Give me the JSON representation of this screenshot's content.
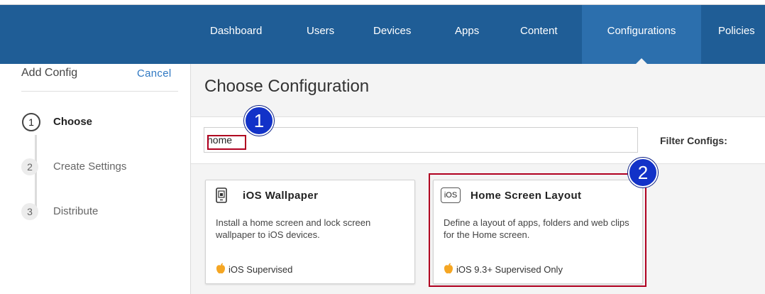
{
  "nav": {
    "items": [
      {
        "label": "Dashboard",
        "active": false
      },
      {
        "label": "Users",
        "active": false
      },
      {
        "label": "Devices",
        "active": false
      },
      {
        "label": "Apps",
        "active": false
      },
      {
        "label": "Content",
        "active": false
      },
      {
        "label": "Configurations",
        "active": true
      },
      {
        "label": "Policies",
        "active": false
      }
    ]
  },
  "sidebar": {
    "title": "Add Config",
    "cancel_label": "Cancel",
    "steps": [
      {
        "number": "1",
        "label": "Choose",
        "active": true
      },
      {
        "number": "2",
        "label": "Create Settings",
        "active": false
      },
      {
        "number": "3",
        "label": "Distribute",
        "active": false
      }
    ]
  },
  "main": {
    "title": "Choose Configuration",
    "search": {
      "value": "home",
      "placeholder": ""
    },
    "filter_label": "Filter Configs:",
    "cards": [
      {
        "title": "iOS Wallpaper",
        "description": "Install a home screen and lock screen wallpaper to iOS devices.",
        "footer": "iOS Supervised",
        "icon": "phone-wallpaper-icon"
      },
      {
        "title": "Home Screen Layout",
        "description": "Define a layout of apps, folders and web clips for the Home screen.",
        "footer": "iOS 9.3+ Supervised Only",
        "icon_text": "iOS",
        "icon": "ios-badge-icon"
      }
    ]
  },
  "callouts": [
    "1",
    "2"
  ],
  "colors": {
    "nav_bg": "#1f5d96",
    "nav_active": "#2c6fad",
    "link": "#2f78c2",
    "highlight": "#b00020",
    "callout": "#1232c8",
    "apple_icon": "#f5a623"
  }
}
